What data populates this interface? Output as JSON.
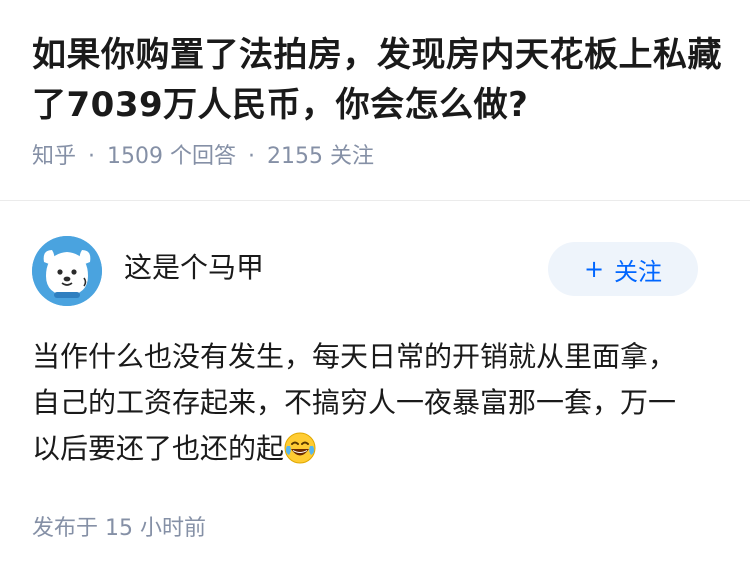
{
  "question": {
    "title": "如果你购置了法拍房，发现房内天花板上私藏了7039万人民币，你会怎么做?",
    "source": "知乎",
    "answer_count": "1509 个回答",
    "follower_count": "2155 关注"
  },
  "answer": {
    "author": {
      "name": "这是个马甲",
      "follow_label": "关注",
      "follow_plus": "+"
    },
    "body": "当作什么也没有发生，每天日常的开销就从里面拿，自己的工资存起来，不搞穷人一夜暴富那一套，万一以后要还了也还的起",
    "emoji": "laughing-tears-icon",
    "published": "发布于 15 小时前"
  },
  "colors": {
    "meta_gray": "#8590a6",
    "accent_blue": "#0066ff",
    "follow_bg": "#eef4fb",
    "avatar_blue": "#4aa3df"
  }
}
